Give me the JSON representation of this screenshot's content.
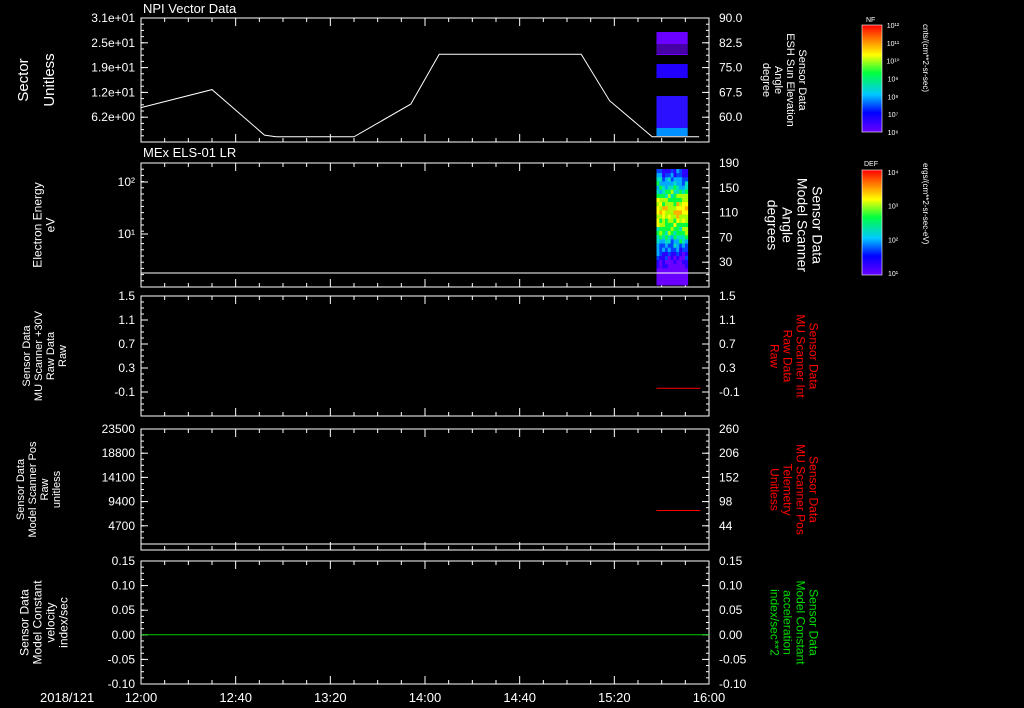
{
  "colors": {
    "background": "#000000",
    "axis": "#ffffff",
    "trace_white": "#ffffff",
    "trace_red": "#ff0000",
    "trace_green": "#00cc00",
    "right_label_red": "#ff0000",
    "right_label_green": "#00dd00"
  },
  "footer": {
    "date_label": "2018/121",
    "time_ticks": [
      "12:00",
      "12:40",
      "13:20",
      "14:00",
      "14:40",
      "15:20",
      "16:00"
    ]
  },
  "chart_data": [
    {
      "type": "line",
      "title": "NPI Vector Data",
      "left_ylabel": [
        "Sector",
        "Unitless"
      ],
      "left_ticks": [
        "3.1e+01",
        "2.5e+01",
        "1.9e+01",
        "1.2e+01",
        "6.2e+00"
      ],
      "right_ylabel": [
        "Sensor Data",
        "ESH Sun Elevation",
        "Angle",
        "degree"
      ],
      "right_ticks": [
        "90.0",
        "82.5",
        "75.0",
        "67.5",
        "60.0"
      ],
      "ylim_right": [
        54,
        90
      ],
      "xlim_hours": [
        0,
        4
      ],
      "series": [
        {
          "color": "#ffffff",
          "x_hours": [
            0,
            0.5,
            0.87,
            0.95,
            1.12,
            1.5,
            1.9,
            2.1,
            3.1,
            3.3,
            3.6,
            3.93
          ],
          "y": [
            64.0,
            69.2,
            56.0,
            55.5,
            55.5,
            55.5,
            65.0,
            79.5,
            79.5,
            66.0,
            55.5,
            55.5
          ]
        }
      ],
      "spectrogram_overlay": {
        "x_start_hours": 3.63,
        "x_end_hours": 3.85,
        "colorbar_label": "NF",
        "colorbar_units": "cnts/(cm**2-sr-sec)",
        "colorbar_ticks": [
          "10¹²",
          "10¹¹",
          "10¹⁰",
          "10⁹",
          "10⁸",
          "10⁷",
          "10⁶"
        ]
      }
    },
    {
      "type": "heatmap",
      "title": "MEx ELS-01 LR",
      "left_ylabel": [
        "Electron Energy",
        "eV"
      ],
      "left_ticks": [
        "10²",
        "10¹"
      ],
      "right_ylabel": [
        "Sensor Data",
        "Model Scanner",
        "Angle",
        "degrees"
      ],
      "right_ticks": [
        "190",
        "150",
        "110",
        "70",
        "30"
      ],
      "ylim_right": [
        0,
        190
      ],
      "baseline_value": 10,
      "spectrogram_x_hours": [
        3.63,
        3.85
      ],
      "colorbar_label": "DEF",
      "colorbar_units": "ergs/(cm**2-sr-sec-eV)",
      "colorbar_ticks": [
        "10⁴",
        "10³",
        "10²",
        "10¹"
      ]
    },
    {
      "type": "line",
      "left_ylabel": [
        "Sensor Data",
        "MU Scanner +30V",
        "Raw Data",
        "Raw"
      ],
      "left_ticks": [
        "1.5",
        "1.1",
        "0.7",
        "0.3",
        "-0.1"
      ],
      "right_ylabel": [
        "Sensor Data",
        "MU Scanner Int",
        "Raw Data",
        "Raw"
      ],
      "right_ticks": [
        "1.5",
        "1.1",
        "0.7",
        "0.3",
        "-0.1"
      ],
      "ylim": [
        -0.45,
        1.5
      ],
      "series": [
        {
          "color": "#ff0000",
          "x_hours": [
            3.63,
            3.94
          ],
          "y": [
            0.0,
            0.0
          ]
        }
      ]
    },
    {
      "type": "line",
      "left_ylabel": [
        "Sensor Data",
        "Model Scanner Pos",
        "Raw",
        "unitless"
      ],
      "left_ticks": [
        "23500",
        "18800",
        "14100",
        "9400",
        "4700"
      ],
      "right_ylabel": [
        "Sensor Data",
        "MU Scanner Pos",
        "Telemetry",
        "Unitless"
      ],
      "right_ticks": [
        "260",
        "206",
        "152",
        "98",
        "44"
      ],
      "ylim_right": [
        0,
        260
      ],
      "series": [
        {
          "color": "#ff0000",
          "x_hours": [
            3.63,
            3.94
          ],
          "y": [
            85,
            85
          ]
        }
      ]
    },
    {
      "type": "line",
      "left_ylabel": [
        "Sensor Data",
        "Model Constant",
        "velocity",
        "index/sec"
      ],
      "left_ticks": [
        "0.15",
        "0.10",
        "0.05",
        "0.00",
        "-0.05",
        "-0.10"
      ],
      "right_ylabel": [
        "Sensor Data",
        "Model Constant",
        "acceleration",
        "index/sec**2"
      ],
      "right_ticks": [
        "0.15",
        "0.10",
        "0.05",
        "0.00",
        "-0.05",
        "-0.10"
      ],
      "ylim": [
        -0.1,
        0.15
      ],
      "series": [
        {
          "color": "#00cc00",
          "x_hours": [
            0,
            4
          ],
          "y": [
            0.0,
            0.0
          ]
        }
      ]
    }
  ]
}
